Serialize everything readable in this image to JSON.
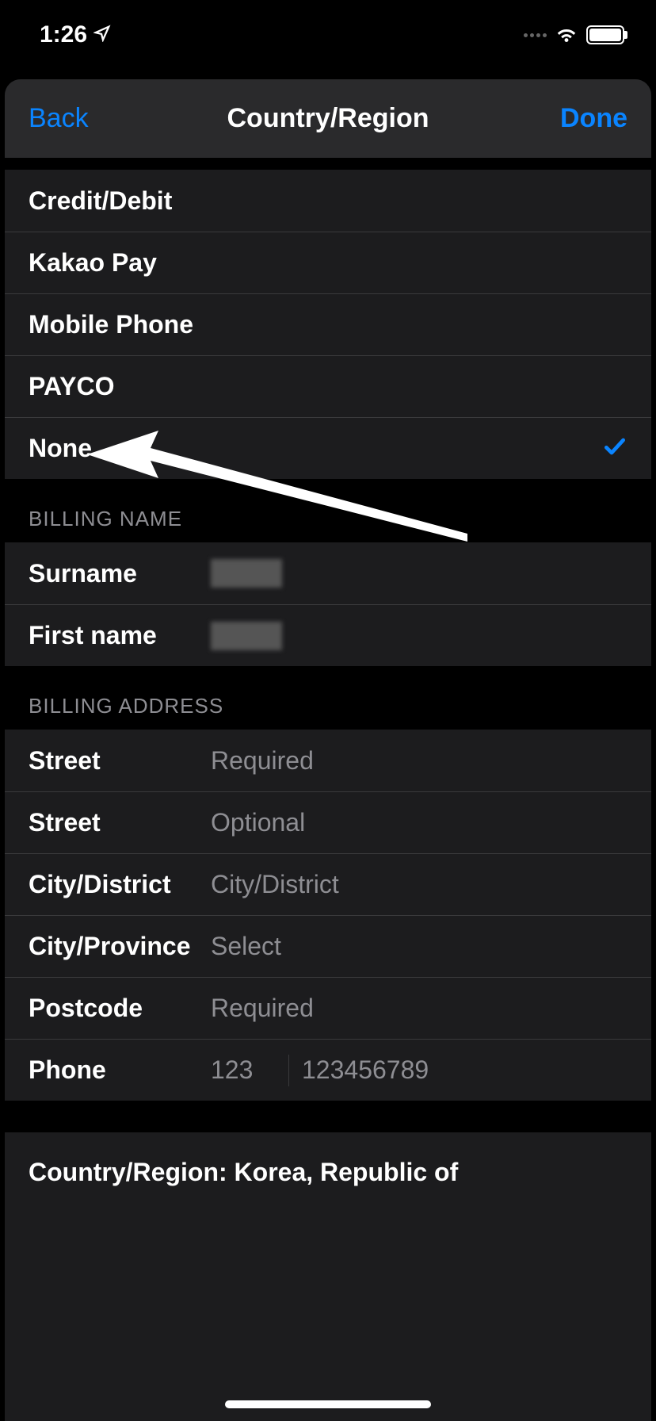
{
  "status": {
    "time": "1:26"
  },
  "nav": {
    "back": "Back",
    "title": "Country/Region",
    "done": "Done"
  },
  "payment_methods": [
    {
      "label": "Credit/Debit",
      "selected": false
    },
    {
      "label": "Kakao Pay",
      "selected": false
    },
    {
      "label": "Mobile Phone",
      "selected": false
    },
    {
      "label": "PAYCO",
      "selected": false
    },
    {
      "label": "None",
      "selected": true
    }
  ],
  "sections": {
    "billing_name": "BILLING NAME",
    "billing_address": "BILLING ADDRESS"
  },
  "billing_name": {
    "surname_label": "Surname",
    "firstname_label": "First name"
  },
  "billing_address": {
    "street1_label": "Street",
    "street1_placeholder": "Required",
    "street2_label": "Street",
    "street2_placeholder": "Optional",
    "city_label": "City/District",
    "city_placeholder": "City/District",
    "province_label": "City/Province",
    "province_placeholder": "Select",
    "postcode_label": "Postcode",
    "postcode_placeholder": "Required",
    "phone_label": "Phone",
    "phone_prefix_placeholder": "123",
    "phone_number_placeholder": "123456789"
  },
  "country": {
    "label": "Country/Region: Korea, Republic of"
  }
}
